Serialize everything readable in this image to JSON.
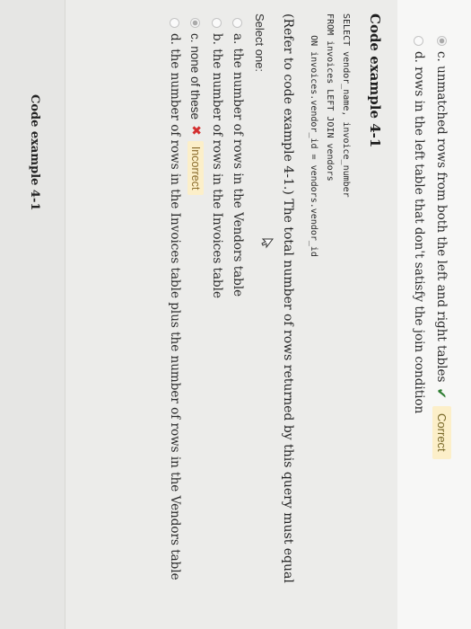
{
  "previous_question": {
    "option_c": "c. unmatched rows from both the left and right tables",
    "option_c_badge": "Correct",
    "option_d": "d. rows in the left table that don't satisfy the join condition"
  },
  "code_example": {
    "heading": "Code example 4-1",
    "lines": [
      "SELECT vendor_name, invoice_number",
      "FROM invoices LEFT JOIN vendors",
      "    ON invoices.vendor_id = vendors.vendor_id"
    ]
  },
  "question": {
    "text": "(Refer to code example 4-1.) The total number of rows returned by this query must equal",
    "select_label": "Select one:",
    "options": [
      {
        "label": "a. the number of rows in the Vendors table"
      },
      {
        "label": "b. the number of rows in the Invoices table"
      },
      {
        "label": "c. none of these",
        "badge": "Incorrect"
      },
      {
        "label": "d. the number of rows in the Invoices table plus the number of rows in the Vendors table"
      }
    ]
  },
  "footer": {
    "label": "Code example 4-1"
  },
  "colors": {
    "correct": "#2e7d32",
    "incorrect": "#d32f2f",
    "badge_bg": "#fcefc9"
  }
}
